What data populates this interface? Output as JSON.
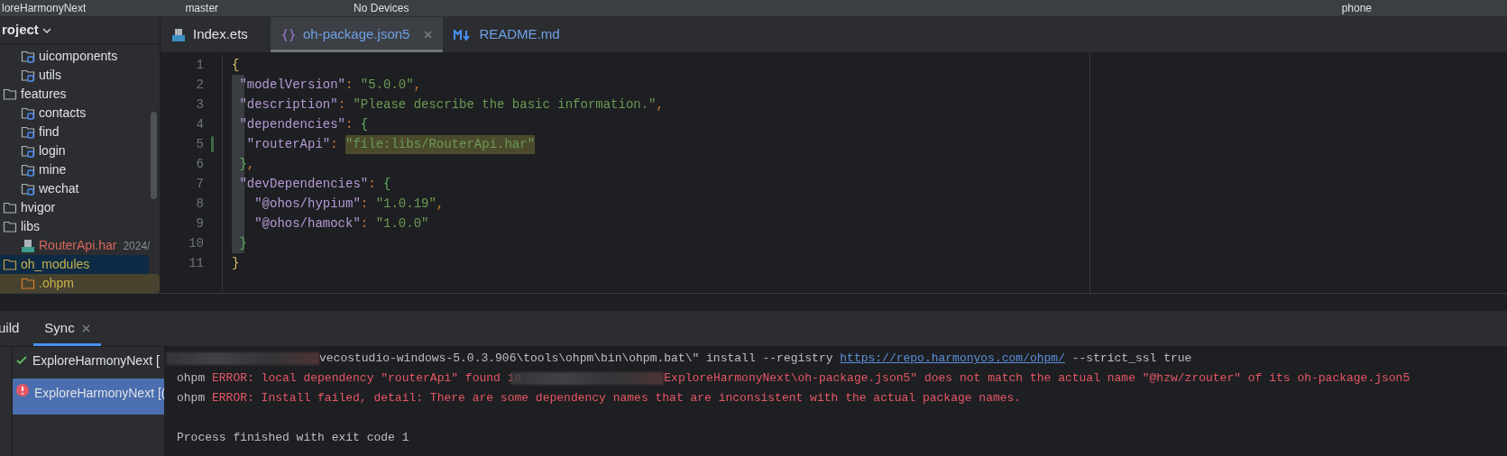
{
  "top_bar": {
    "project": "loreHarmonyNext",
    "branch": "master",
    "device": "No Devices",
    "target": "phone"
  },
  "project_panel": {
    "title": "roject",
    "tree": [
      {
        "children": [
          {
            "label": "uicomponents",
            "kind": "module",
            "selected": false
          },
          {
            "label": "utils",
            "kind": "module",
            "selected": false
          }
        ]
      },
      {
        "label": "features",
        "kind": "folder",
        "selected": false,
        "children": [
          {
            "label": "contacts",
            "kind": "module",
            "selected": false
          },
          {
            "label": "find",
            "kind": "module",
            "selected": false
          },
          {
            "label": "login",
            "kind": "module",
            "selected": false
          },
          {
            "label": "mine",
            "kind": "module",
            "selected": false
          },
          {
            "label": "wechat",
            "kind": "module",
            "selected": false
          }
        ]
      },
      {
        "label": "hvigor",
        "kind": "folder",
        "selected": false
      },
      {
        "label": "libs",
        "kind": "folder",
        "selected": false,
        "children": [
          {
            "label": "RouterApi.har",
            "kind": "har",
            "note": "2024/",
            "selected": false
          }
        ]
      },
      {
        "label": "oh_modules",
        "kind": "ignored",
        "selected": true,
        "children": [
          {
            "label": ".ohpm",
            "kind": "ignored-child",
            "selected": false
          }
        ]
      }
    ]
  },
  "editor_tabs": [
    {
      "label": "Index.ets",
      "kind": "ets",
      "selected": false,
      "closable": false
    },
    {
      "label": "oh-package.json5",
      "kind": "json",
      "selected": true,
      "closable": true
    },
    {
      "label": "README.md",
      "kind": "md",
      "selected": false,
      "closable": false
    }
  ],
  "code": [
    {
      "number": "1",
      "changed": false,
      "tokens": [
        {
          "kind": "brace",
          "text": "{"
        }
      ]
    },
    {
      "number": "2",
      "changed": false,
      "tokens": [
        {
          "kind": "key",
          "text": " \"modelVersion\""
        },
        {
          "kind": "punct",
          "text": ": "
        },
        {
          "kind": "string",
          "text": "\"5.0.0\""
        },
        {
          "kind": "punct",
          "text": ","
        }
      ]
    },
    {
      "number": "3",
      "changed": false,
      "tokens": [
        {
          "kind": "key",
          "text": " \"description\""
        },
        {
          "kind": "punct",
          "text": ": "
        },
        {
          "kind": "string",
          "text": "\"Please describe the basic information.\""
        },
        {
          "kind": "punct",
          "text": ","
        }
      ]
    },
    {
      "number": "4",
      "changed": false,
      "tokens": [
        {
          "kind": "key",
          "text": " \"dependencies\""
        },
        {
          "kind": "punct",
          "text": ": "
        },
        {
          "kind": "inner-brace",
          "text": "{"
        }
      ]
    },
    {
      "number": "5",
      "changed": true,
      "tokens": [
        {
          "kind": "key",
          "text": "  \"routerApi\""
        },
        {
          "kind": "punct",
          "text": ": "
        },
        {
          "kind": "string-highlighted",
          "text": "\"file:libs/RouterApi.har\""
        }
      ]
    },
    {
      "number": "6",
      "changed": false,
      "tokens": [
        {
          "kind": "inner-brace",
          "text": " }"
        },
        {
          "kind": "punct",
          "text": ","
        }
      ]
    },
    {
      "number": "7",
      "changed": false,
      "tokens": [
        {
          "kind": "key",
          "text": " \"devDependencies\""
        },
        {
          "kind": "punct",
          "text": ": "
        },
        {
          "kind": "inner-brace",
          "text": "{"
        }
      ]
    },
    {
      "number": "8",
      "changed": false,
      "tokens": [
        {
          "kind": "key",
          "text": "   \"@ohos/hypium\""
        },
        {
          "kind": "punct",
          "text": ": "
        },
        {
          "kind": "string",
          "text": "\"1.0.19\""
        },
        {
          "kind": "punct",
          "text": ","
        }
      ]
    },
    {
      "number": "9",
      "changed": false,
      "tokens": [
        {
          "kind": "key",
          "text": "   \"@ohos/hamock\""
        },
        {
          "kind": "punct",
          "text": ": "
        },
        {
          "kind": "string",
          "text": "\"1.0.0\""
        }
      ]
    },
    {
      "number": "10",
      "changed": false,
      "tokens": [
        {
          "kind": "inner-brace",
          "text": " }"
        }
      ]
    },
    {
      "number": "11",
      "changed": false,
      "tokens": [
        {
          "kind": "brace",
          "text": "}"
        }
      ]
    }
  ],
  "bottom_tabs": [
    {
      "label": "uild",
      "selected": false,
      "closable": false
    },
    {
      "label": "Sync",
      "selected": true,
      "closable": true
    }
  ],
  "sync_tree": [
    {
      "label": "ExploreHarmonyNext [",
      "kind": "success",
      "selected": false
    },
    {
      "label": "ExploreHarmonyNext [(",
      "kind": "error",
      "selected": true
    }
  ],
  "log": [
    [
      {
        "kind": "redacted"
      },
      {
        "kind": "text",
        "text": "vecostudio-windows-5.0.3.906\\tools\\ohpm\\bin\\ohpm.bat\\\" install --registry "
      },
      {
        "kind": "link",
        "text": "https://repo.harmonyos.com/ohpm/"
      },
      {
        "kind": "text",
        "text": " --strict_ssl true"
      }
    ],
    [
      {
        "kind": "text",
        "text": "ohpm "
      },
      {
        "kind": "error",
        "text": "ERROR: local dependency \"routerApi\" found in"
      },
      {
        "kind": "redacted"
      },
      {
        "kind": "error",
        "text": "ExploreHarmonyNext\\oh-package.json5\" does not match the actual name \"@hzw/zrouter\" of its oh-package.json5"
      }
    ],
    [
      {
        "kind": "text",
        "text": "ohpm "
      },
      {
        "kind": "error",
        "text": "ERROR: Install failed, detail: There are some dependency names that are inconsistent with the actual package names."
      }
    ],
    [
      {
        "kind": "text",
        "text": "Process finished with exit code 1"
      }
    ]
  ]
}
